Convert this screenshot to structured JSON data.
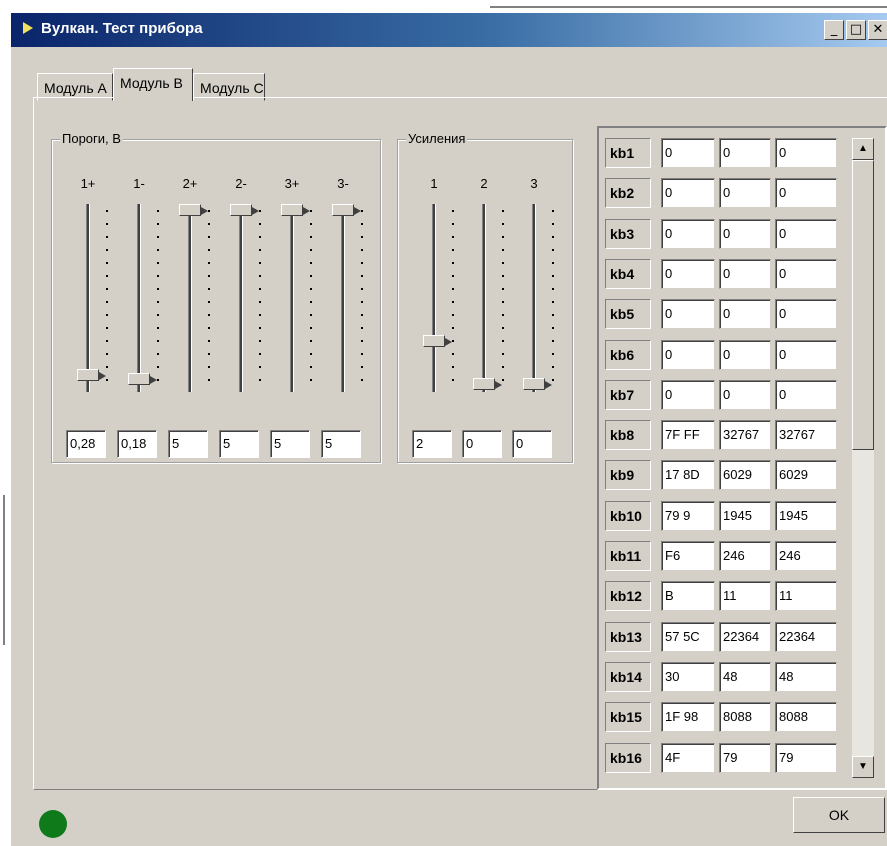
{
  "window": {
    "title": "Вулкан. Тест прибора",
    "controls": [
      "_",
      "□",
      "✕"
    ]
  },
  "tabs": [
    {
      "label": "Модуль А",
      "active": false
    },
    {
      "label": "Модуль В",
      "active": true
    },
    {
      "label": "Модуль С",
      "active": false
    }
  ],
  "thresholds": {
    "title": "Пороги, В",
    "columns": [
      {
        "label": "1+",
        "value": "0,28",
        "level": 0.05
      },
      {
        "label": "1-",
        "value": "0,18",
        "level": 0.03
      },
      {
        "label": "2+",
        "value": "5",
        "level": 1.0
      },
      {
        "label": "2-",
        "value": "5",
        "level": 1.0
      },
      {
        "label": "3+",
        "value": "5",
        "level": 1.0
      },
      {
        "label": "3-",
        "value": "5",
        "level": 1.0
      }
    ]
  },
  "gains": {
    "title": "Усиления",
    "columns": [
      {
        "label": "1",
        "value": "2",
        "level": 0.25
      },
      {
        "label": "2",
        "value": "0",
        "level": 0.0
      },
      {
        "label": "3",
        "value": "0",
        "level": 0.0
      }
    ]
  },
  "kb": [
    {
      "label": "kb1",
      "hex": "0",
      "v1": "0",
      "v2": "0"
    },
    {
      "label": "kb2",
      "hex": "0",
      "v1": "0",
      "v2": "0"
    },
    {
      "label": "kb3",
      "hex": "0",
      "v1": "0",
      "v2": "0"
    },
    {
      "label": "kb4",
      "hex": "0",
      "v1": "0",
      "v2": "0"
    },
    {
      "label": "kb5",
      "hex": "0",
      "v1": "0",
      "v2": "0"
    },
    {
      "label": "kb6",
      "hex": "0",
      "v1": "0",
      "v2": "0"
    },
    {
      "label": "kb7",
      "hex": "0",
      "v1": "0",
      "v2": "0"
    },
    {
      "label": "kb8",
      "hex": "7F FF",
      "v1": "32767",
      "v2": "32767"
    },
    {
      "label": "kb9",
      "hex": "17 8D",
      "v1": "6029",
      "v2": "6029"
    },
    {
      "label": "kb10",
      "hex": "79 9",
      "v1": "1945",
      "v2": "1945"
    },
    {
      "label": "kb11",
      "hex": "F6",
      "v1": "246",
      "v2": "246"
    },
    {
      "label": "kb12",
      "hex": "B",
      "v1": "11",
      "v2": "11"
    },
    {
      "label": "kb13",
      "hex": "57 5C",
      "v1": "22364",
      "v2": "22364"
    },
    {
      "label": "kb14",
      "hex": "30",
      "v1": "48",
      "v2": "48"
    },
    {
      "label": "kb15",
      "hex": "1F 98",
      "v1": "8088",
      "v2": "8088"
    },
    {
      "label": "kb16",
      "hex": "4F",
      "v1": "79",
      "v2": "79"
    }
  ],
  "scroll": {
    "up_icon": "▲",
    "down_icon": "▼"
  },
  "status": {
    "led_color": "#0f7a1a"
  },
  "ok_label": "OK"
}
